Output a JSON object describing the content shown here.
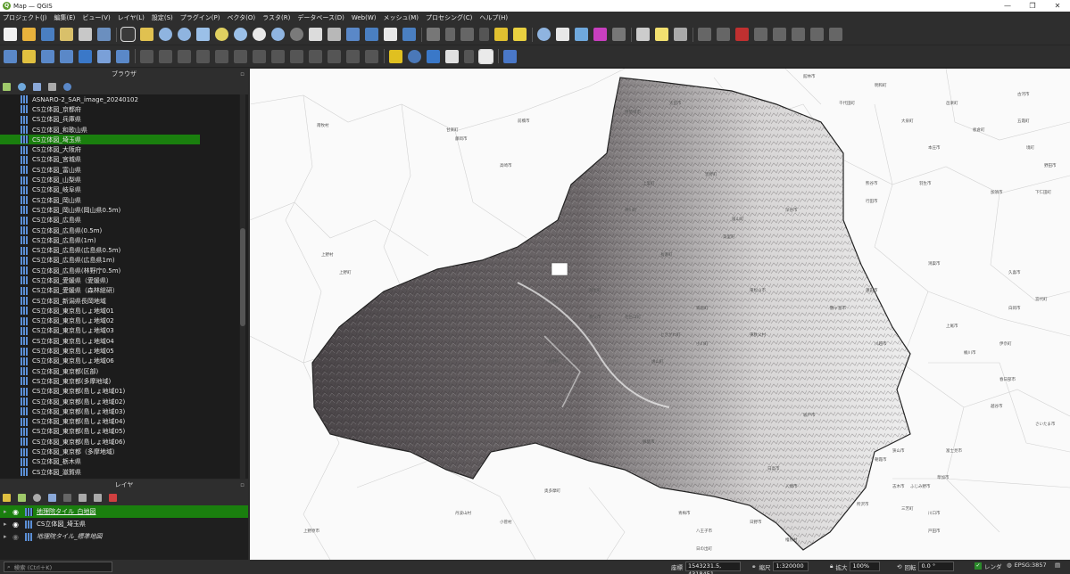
{
  "window": {
    "title": "Map — QGIS",
    "minimize": "—",
    "maximize": "❐",
    "close": "✕"
  },
  "menu": [
    "プロジェクト(J)",
    "編集(E)",
    "ビュー(V)",
    "レイヤ(L)",
    "設定(S)",
    "プラグイン(P)",
    "ベクタ(O)",
    "ラスタ(R)",
    "データベース(D)",
    "Web(W)",
    "メッシュ(M)",
    "プロセシング(C)",
    "ヘルプ(H)"
  ],
  "browser": {
    "title": "ブラウザ",
    "selected_index": 4,
    "items": [
      "ASNARO-2_SAR_image_20240102",
      "CS立体図_京都府",
      "CS立体図_兵庫県",
      "CS立体図_和歌山県",
      "CS立体図_埼玉県",
      "CS立体図_大阪府",
      "CS立体図_宮城県",
      "CS立体図_富山県",
      "CS立体図_山梨県",
      "CS立体図_岐阜県",
      "CS立体図_岡山県",
      "CS立体図_岡山県(岡山県0.5m)",
      "CS立体図_広島県",
      "CS立体図_広島県(0.5m)",
      "CS立体図_広島県(1m)",
      "CS立体図_広島県(広島県0.5m)",
      "CS立体図_広島県(広島県1m)",
      "CS立体図_広島県(林野庁0.5m)",
      "CS立体図_愛媛県（愛媛県）",
      "CS立体図_愛媛県（森林総研）",
      "CS立体図_新潟県長岡地域",
      "CS立体図_東京島しょ地域01",
      "CS立体図_東京島しょ地域02",
      "CS立体図_東京島しょ地域03",
      "CS立体図_東京島しょ地域04",
      "CS立体図_東京島しょ地域05",
      "CS立体図_東京島しょ地域06",
      "CS立体図_東京都(区部)",
      "CS立体図_東京都(多摩地域)",
      "CS立体図_東京都(島しょ地域01)",
      "CS立体図_東京都(島しょ地域02)",
      "CS立体図_東京都(島しょ地域03)",
      "CS立体図_東京都(島しょ地域04)",
      "CS立体図_東京都(島しょ地域05)",
      "CS立体図_東京都(島しょ地域06)",
      "CS立体図_東京都（多摩地域）",
      "CS立体図_栃木県",
      "CS立体図_滋賀県"
    ]
  },
  "layers": {
    "title": "レイヤ",
    "items": [
      {
        "name": "地理院タイル_白地図",
        "visible": true,
        "selected": true
      },
      {
        "name": "CS立体図_埼玉県",
        "visible": true,
        "selected": false
      },
      {
        "name": "地理院タイル_標準地図",
        "visible": false,
        "selected": false
      }
    ]
  },
  "map_labels": [
    "上野町",
    "嵐山町",
    "寄居町",
    "皆野町",
    "小鹿野町",
    "長瀞町",
    "本庄市",
    "熊谷市",
    "東松山市",
    "秩父市",
    "飯能市",
    "日高市",
    "坂戸市",
    "川越市",
    "入間市",
    "狭山市",
    "所沢市",
    "さいたま市",
    "久喜市",
    "加須市",
    "羽生市",
    "行田市",
    "鴻巣市",
    "桶川市",
    "上尾市",
    "伊奈町",
    "蓮田市",
    "白岡市",
    "宮代町",
    "春日部市",
    "越谷市",
    "草加市",
    "川口市",
    "戸田市",
    "志木市",
    "朝霞市",
    "富士見市",
    "ふじみ野市",
    "三芳町",
    "青梅市",
    "奥多摩町",
    "丹波山村",
    "小菅村",
    "上野村",
    "神流町",
    "甘楽町",
    "藤岡市",
    "高崎市",
    "前橋市",
    "伊勢崎市",
    "太田市",
    "館林市",
    "明和町",
    "千代田町",
    "大泉町",
    "邑楽町",
    "板倉町",
    "古河市",
    "五霞町",
    "境町",
    "野田市",
    "下仁田町",
    "南牧村",
    "上野原市",
    "檜原村",
    "日の出町",
    "日野市",
    "八王子市",
    "鶴ヶ島市",
    "毛呂山町",
    "越生町",
    "鳩山町",
    "ときがわ町",
    "小川町",
    "東秩父村",
    "美里町",
    "深谷市",
    "神川町",
    "上里町"
  ],
  "status": {
    "search_placeholder": "検索 (Ctrl＋K)",
    "coord_label": "座標",
    "coord_value": "1543231.5, 4318451",
    "scale_label": "縮尺",
    "scale_value": "1:320000",
    "magnifier_label": "拡大",
    "magnifier_value": "100%",
    "rotation_label": "回転",
    "rotation_value": "0.0 °",
    "render_label": "レンダ",
    "crs": "EPSG:3857"
  }
}
